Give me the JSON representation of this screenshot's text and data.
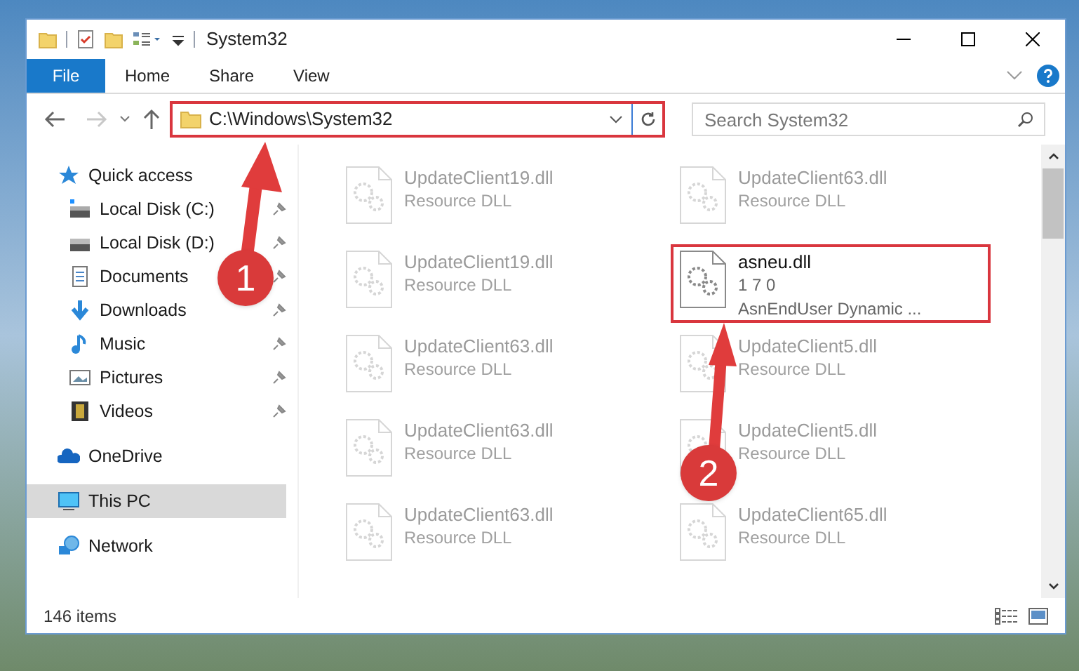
{
  "window": {
    "title": "System32"
  },
  "ribbon": {
    "file_menu": "File",
    "tabs": [
      {
        "label": "Home",
        "selected": false
      },
      {
        "label": "Share",
        "selected": false
      },
      {
        "label": "View",
        "selected": false
      }
    ]
  },
  "address_bar": {
    "path": "C:\\Windows\\System32",
    "highlighted": true
  },
  "search": {
    "placeholder": "Search System32"
  },
  "sidebar": {
    "items": [
      {
        "label": "Quick access",
        "selected": false,
        "children": [
          {
            "label": "Local Disk (C:)",
            "pinned": true,
            "selected": false
          },
          {
            "label": "Local Disk (D:)",
            "pinned": true,
            "selected": false
          },
          {
            "label": "Documents",
            "pinned": true,
            "selected": false
          },
          {
            "label": "Downloads",
            "pinned": true,
            "selected": false
          },
          {
            "label": "Music",
            "pinned": true,
            "selected": false
          },
          {
            "label": "Pictures",
            "pinned": true,
            "selected": false
          },
          {
            "label": "Videos",
            "pinned": true,
            "selected": false
          }
        ]
      },
      {
        "label": "OneDrive",
        "selected": false
      },
      {
        "label": "This PC",
        "selected": true
      },
      {
        "label": "Network",
        "selected": false
      }
    ]
  },
  "files": [
    {
      "name": "UpdateClient19.dll",
      "lines": [
        "Resource DLL"
      ],
      "dimmed": true,
      "highlighted": false
    },
    {
      "name": "UpdateClient63.dll",
      "lines": [
        "Resource DLL"
      ],
      "dimmed": true,
      "highlighted": false
    },
    {
      "name": "UpdateClient19.dll",
      "lines": [
        "Resource DLL"
      ],
      "dimmed": true,
      "highlighted": false
    },
    {
      "name": "asneu.dll",
      "lines": [
        "1 7 0",
        "AsnEndUser Dynamic ..."
      ],
      "dimmed": false,
      "highlighted": true
    },
    {
      "name": "UpdateClient63.dll",
      "lines": [
        "Resource DLL"
      ],
      "dimmed": true,
      "highlighted": false
    },
    {
      "name": "UpdateClient5.dll",
      "lines": [
        "Resource DLL"
      ],
      "dimmed": true,
      "highlighted": false
    },
    {
      "name": "UpdateClient63.dll",
      "lines": [
        "Resource DLL"
      ],
      "dimmed": true,
      "highlighted": false
    },
    {
      "name": "UpdateClient5.dll",
      "lines": [
        "Resource DLL"
      ],
      "dimmed": true,
      "highlighted": false
    },
    {
      "name": "UpdateClient63.dll",
      "lines": [
        "Resource DLL"
      ],
      "dimmed": true,
      "highlighted": false
    },
    {
      "name": "UpdateClient65.dll",
      "lines": [
        "Resource DLL"
      ],
      "dimmed": true,
      "highlighted": false
    }
  ],
  "status_bar": {
    "item_count": "146 items"
  },
  "annotations": [
    {
      "label": "1"
    },
    {
      "label": "2"
    }
  ]
}
